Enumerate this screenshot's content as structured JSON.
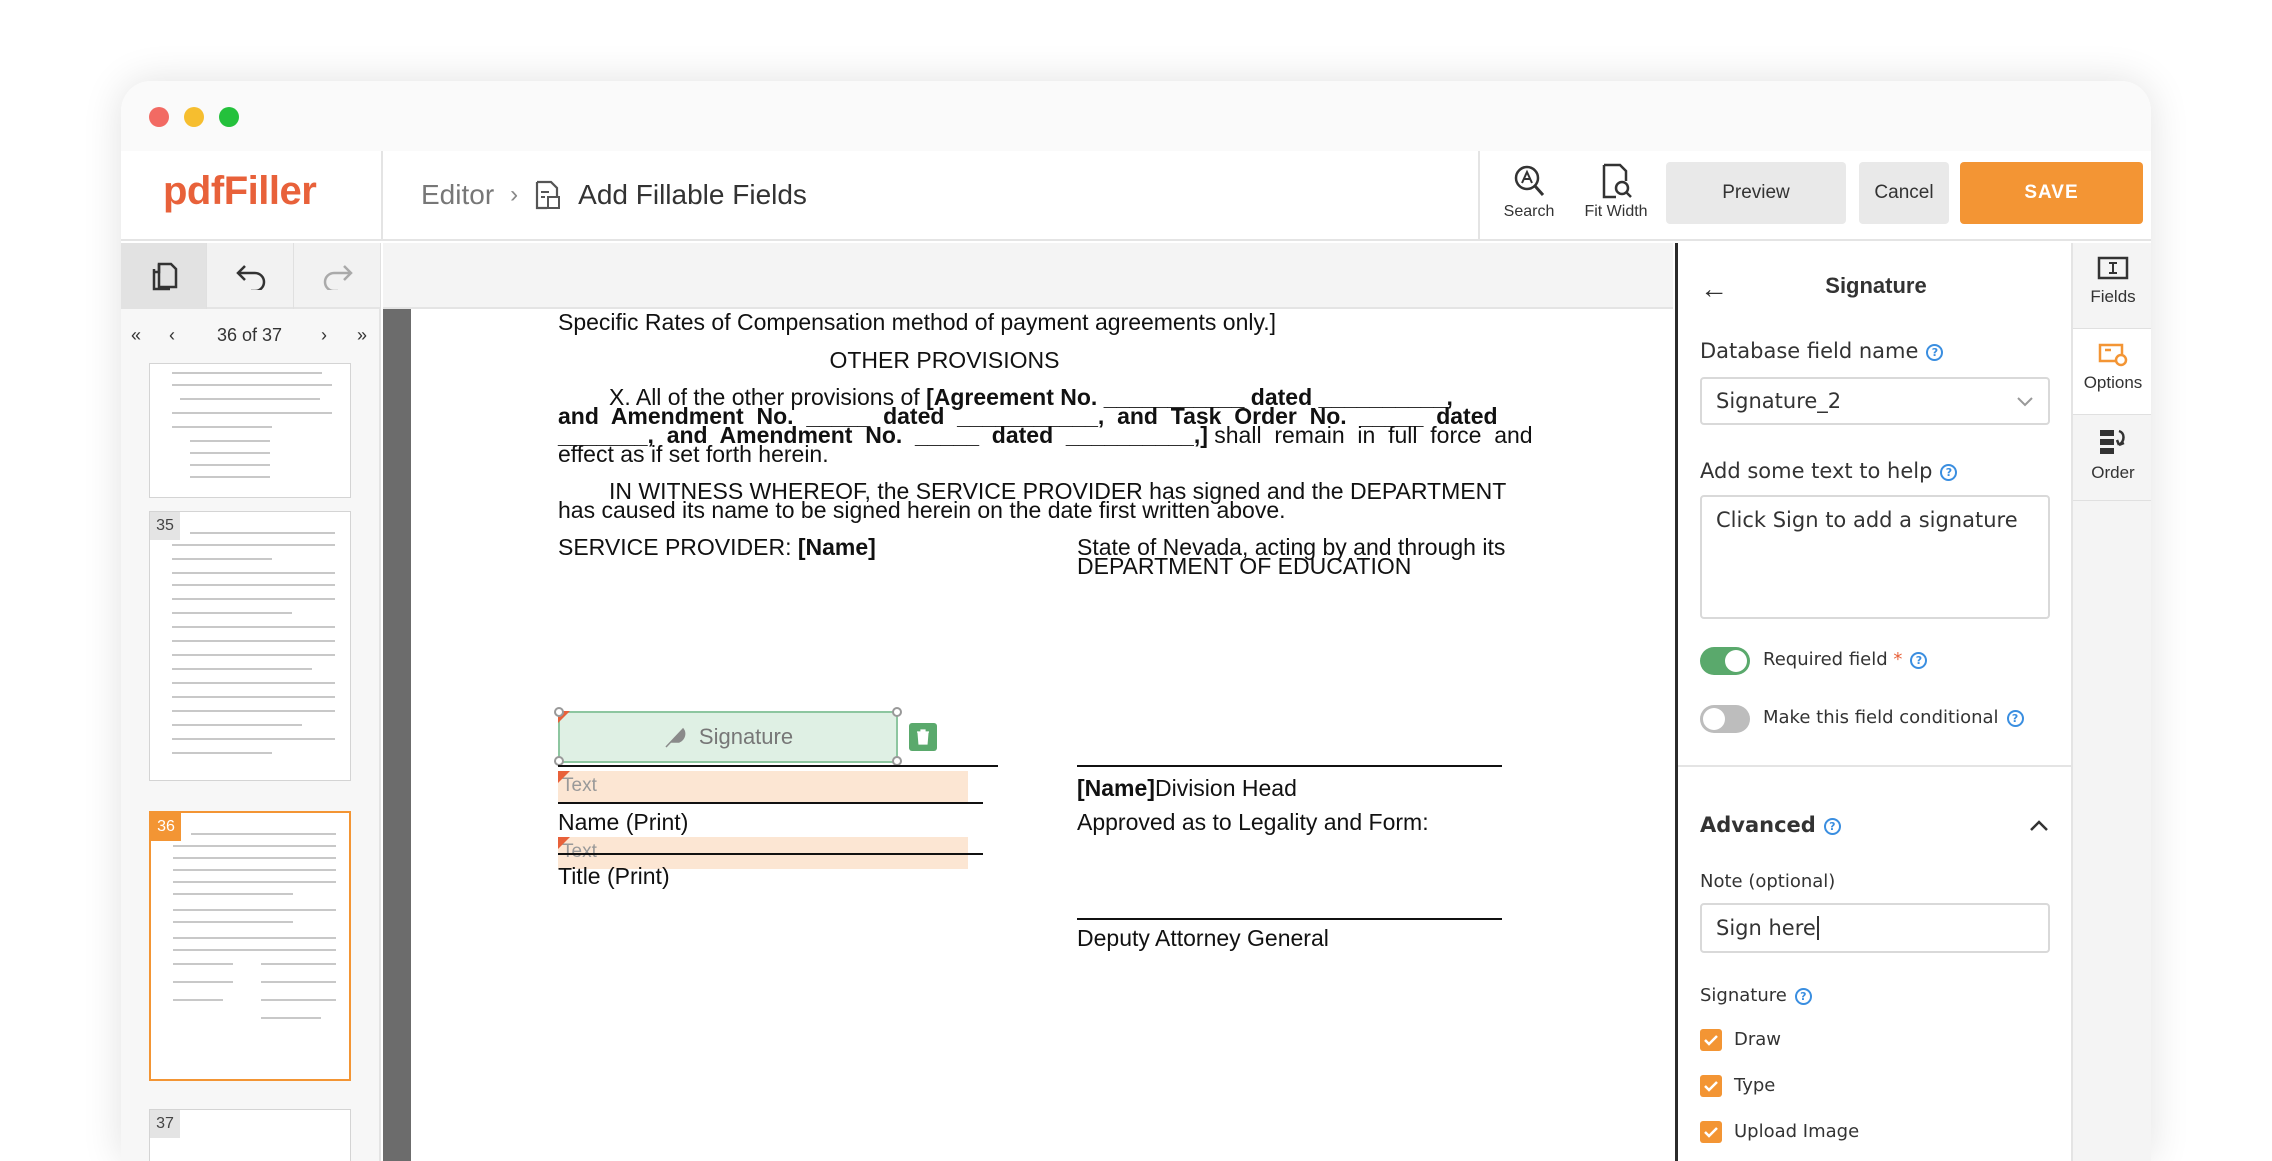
{
  "app": {
    "logo": "pdfFiller"
  },
  "breadcrumb": {
    "parent": "Editor",
    "current": "Add Fillable Fields"
  },
  "toolbar": {
    "search_label": "Search",
    "fit_width_label": "Fit Width",
    "preview_label": "Preview",
    "cancel_label": "Cancel",
    "save_label": "SAVE"
  },
  "pager": {
    "current": "36 of 37"
  },
  "thumbnails": [
    {
      "num": "35"
    },
    {
      "num": "36"
    },
    {
      "num": "37"
    }
  ],
  "document": {
    "line_top": "Specific Rates of Compensation method of payment agreements only.]",
    "heading": "OTHER PROVISIONS",
    "para1_l1_a": "X.      All of the other provisions of ",
    "para1_l1_b": "[Agreement No. ___________ dated __________,",
    "para1_l2": "and  Amendment  No.  _____  dated  ___________,  and  Task  Order  No.  _____  dated",
    "para1_l3_a": "_______,  and  Amendment  No.  _____  dated  __________,]",
    "para1_l3_b": " shall  remain  in  full  force  and",
    "para1_l4": "effect as if set forth herein.",
    "para2_l1": "IN WITNESS WHEREOF, the SERVICE PROVIDER has signed and the DEPARTMENT",
    "para2_l2": "has caused its name to be signed herein on the date first written above.",
    "sp_label": "SERVICE PROVIDER: ",
    "sp_name": "[Name]",
    "state_l1": "State of Nevada, acting by and through its",
    "state_l2": "DEPARTMENT OF EDUCATION",
    "name_bold": "[Name]",
    "division_head": "Division Head",
    "name_print": "Name (Print)",
    "title_print": "Title (Print)",
    "approved": "Approved as to Legality and Form:",
    "deputy": "Deputy Attorney General",
    "sig_field_label": "Signature",
    "text_field_1": "Text",
    "text_field_2": "Text"
  },
  "panel": {
    "title": "Signature",
    "db_field_label": "Database field name",
    "db_field_value": "Signature_2",
    "help_text_label": "Add some text to help",
    "help_text_value": "Click Sign to add a signature",
    "required_label": "Required field",
    "required_star": "*",
    "required_on": true,
    "conditional_label": "Make this field conditional",
    "conditional_on": false,
    "advanced_label": "Advanced",
    "note_label": "Note (optional)",
    "note_value": "Sign here",
    "signature_label": "Signature",
    "options": [
      {
        "label": "Draw",
        "checked": true
      },
      {
        "label": "Type",
        "checked": true
      },
      {
        "label": "Upload Image",
        "checked": true
      }
    ]
  },
  "right_tabs": [
    {
      "label": "Fields",
      "icon": "fields-icon"
    },
    {
      "label": "Options",
      "icon": "options-icon"
    },
    {
      "label": "Order",
      "icon": "order-icon"
    }
  ],
  "colors": {
    "brand": "#e8613a",
    "save": "#f39534",
    "toggle_on": "#5aa96c",
    "help": "#3a8ee0"
  }
}
